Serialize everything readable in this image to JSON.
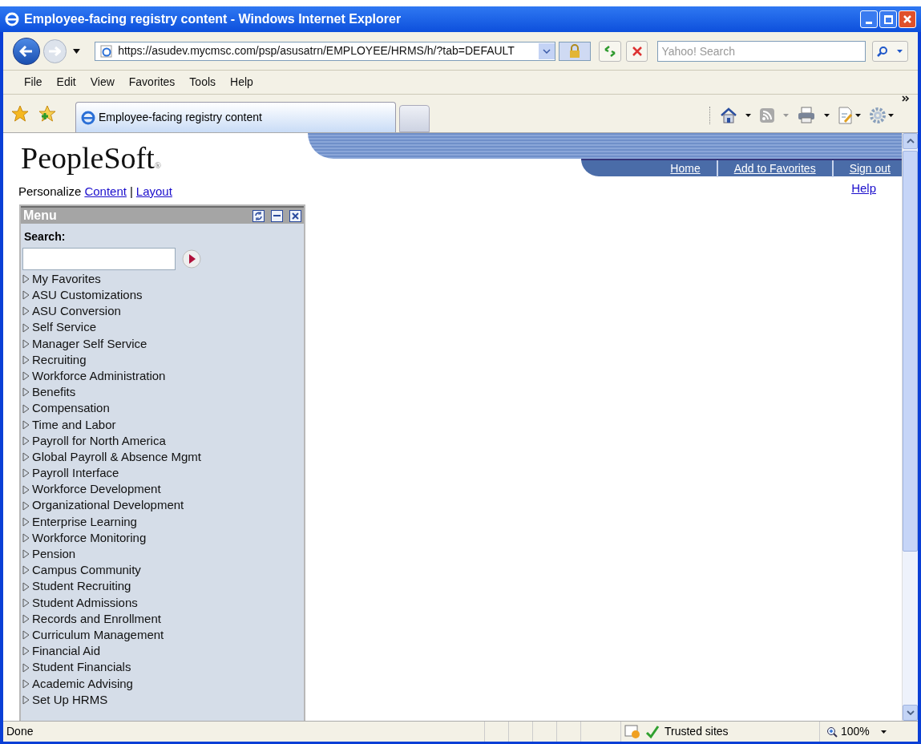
{
  "window": {
    "title": "Employee-facing registry content - Windows Internet Explorer"
  },
  "address_bar": {
    "url": "https://asudev.mycmsc.com/psp/asusatrn/EMPLOYEE/HRMS/h/?tab=DEFAULT"
  },
  "search": {
    "placeholder": "Yahoo! Search"
  },
  "menu_bar": [
    "File",
    "Edit",
    "View",
    "Favorites",
    "Tools",
    "Help"
  ],
  "tabs": [
    {
      "label": "Employee-facing registry content",
      "selected": true
    }
  ],
  "page": {
    "logo": "PeopleSoft",
    "logo_mark": "®",
    "header_links": [
      "Home",
      "Add to Favorites",
      "Sign out"
    ],
    "help_link": "Help",
    "personalize": {
      "label": "Personalize",
      "links": [
        "Content",
        "Layout"
      ],
      "separator": "|"
    },
    "menu": {
      "title": "Menu",
      "search_label": "Search:",
      "items": [
        "My Favorites",
        "ASU Customizations",
        "ASU Conversion",
        "Self Service",
        "Manager Self Service",
        "Recruiting",
        "Workforce Administration",
        "Benefits",
        "Compensation",
        "Time and Labor",
        "Payroll for North America",
        "Global Payroll & Absence Mgmt",
        "Payroll Interface",
        "Workforce Development",
        "Organizational Development",
        "Enterprise Learning",
        "Workforce Monitoring",
        "Pension",
        "Campus Community",
        "Student Recruiting",
        "Student Admissions",
        "Records and Enrollment",
        "Curriculum Management",
        "Financial Aid",
        "Student Financials",
        "Academic Advising",
        "Set Up HRMS"
      ]
    }
  },
  "status_bar": {
    "text": "Done",
    "zone": "Trusted sites",
    "zoom": "100%"
  }
}
